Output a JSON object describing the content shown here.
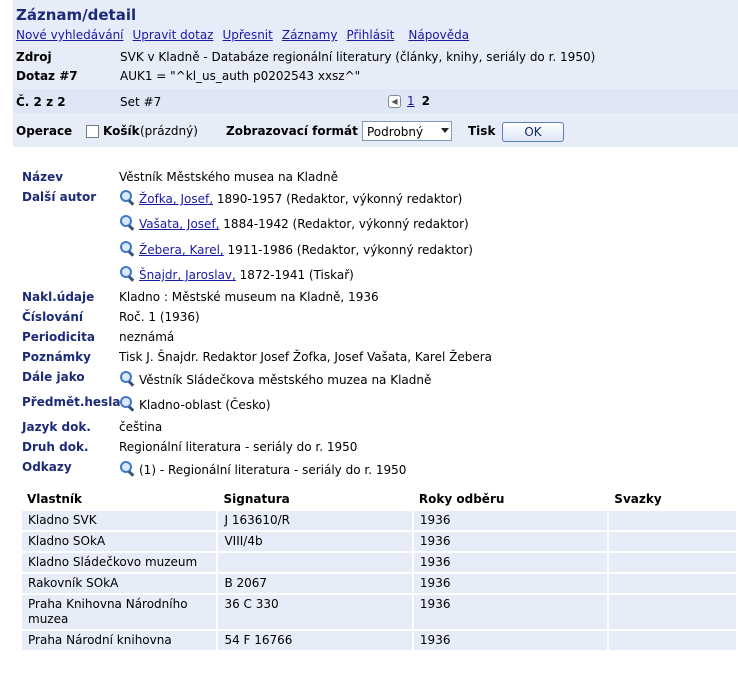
{
  "header": {
    "title": "Záznam/detail",
    "nav": [
      "Nové vyhledávání",
      "Upravit dotaz",
      "Upřesnit",
      "Záznamy",
      "Přihlásit",
      "Nápověda"
    ],
    "zdroj_label": "Zdroj",
    "zdroj_value": "SVK v Kladně - Databáze regionální literatury (články, knihy, seriály do r. 1950)",
    "dotaz_label": "Dotaz #7",
    "dotaz_value": "AUK1 = \"^kl_us_auth p0202543 xxsz^\"",
    "count_label": "Č. 2 z 2",
    "set_label": "Set #7",
    "pager_prev_icon": "prev-arrow-icon",
    "pager_link": "1",
    "pager_current": "2"
  },
  "ops": {
    "operace": "Operace",
    "kosik_label": "Košík",
    "kosik_status": "(prázdný)",
    "format_label": "Zobrazovací formát",
    "format_value": "Podrobný",
    "tisk_label": "Tisk",
    "ok_label": "OK"
  },
  "record": {
    "nazev_label": "Název",
    "nazev": "Věstník Městského musea na Kladně",
    "dalsi_autor_label": "Další autor",
    "authors": [
      {
        "name": "Žofka, Josef,",
        "rest": " 1890-1957 (Redaktor, výkonný redaktor)"
      },
      {
        "name": "Vašata, Josef,",
        "rest": " 1884-1942 (Redaktor, výkonný redaktor)"
      },
      {
        "name": "Žebera, Karel,",
        "rest": " 1911-1986 (Redaktor, výkonný redaktor)"
      },
      {
        "name": "Šnajdr, Jaroslav,",
        "rest": " 1872-1941 (Tiskař)"
      }
    ],
    "nakl_label": "Nakl.údaje",
    "nakl": "Kladno : Městské museum na Kladně, 1936",
    "cislovani_label": "Číslování",
    "cislovani": "Roč. 1 (1936)",
    "periodicita_label": "Periodicita",
    "periodicita": "neznámá",
    "poznamky_label": "Poznámky",
    "poznamky": "Tisk J. Šnajdr. Redaktor Josef Žofka, Josef Vašata, Karel Žebera",
    "dale_label": "Dále jako",
    "dale": "Věstník Sládečkova městského muzea na Kladně",
    "predmet_label": "Předmět.hesla",
    "predmet": "Kladno-oblast (Česko)",
    "jazyk_label": "Jazyk dok.",
    "jazyk": "čeština",
    "druh_label": "Druh dok.",
    "druh": "Regionální literatura - seriály do r. 1950",
    "odkazy_label": "Odkazy",
    "odkazy": "(1) - Regionální literatura - seriály do r. 1950"
  },
  "holdings": {
    "columns": [
      "Vlastník",
      "Signatura",
      "Roky odběru",
      "Svazky"
    ],
    "rows": [
      [
        "Kladno SVK",
        "J 163610/R",
        "1936",
        ""
      ],
      [
        "Kladno SOkA",
        "VIII/4b",
        "1936",
        ""
      ],
      [
        "Kladno Sládečkovo muzeum",
        "",
        "1936",
        ""
      ],
      [
        "Rakovník SOkA",
        "B 2067",
        "1936",
        ""
      ],
      [
        "Praha Knihovna Národního muzea",
        "36 C 330",
        "1936",
        ""
      ],
      [
        "Praha Národní knihovna",
        "54 F 16766",
        "1936",
        ""
      ]
    ]
  }
}
